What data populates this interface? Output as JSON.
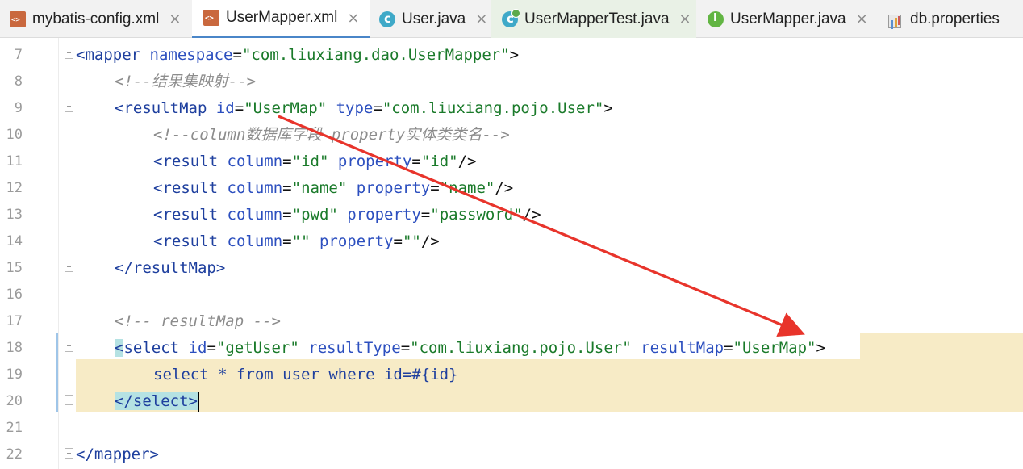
{
  "tabs": [
    {
      "label": "mybatis-config.xml",
      "icon": "xml-file-icon",
      "active": false
    },
    {
      "label": "UserMapper.xml",
      "icon": "xml-file-icon",
      "active": true
    },
    {
      "label": "User.java",
      "icon": "java-class-icon",
      "active": false
    },
    {
      "label": "UserMapperTest.java",
      "icon": "java-test-class-icon",
      "active": false
    },
    {
      "label": "UserMapper.java",
      "icon": "java-interface-icon",
      "active": false
    },
    {
      "label": "db.properties",
      "icon": "properties-file-icon",
      "active": false
    }
  ],
  "close_glyph": "×",
  "lines": [
    {
      "n": "7"
    },
    {
      "n": "8"
    },
    {
      "n": "9"
    },
    {
      "n": "10"
    },
    {
      "n": "11"
    },
    {
      "n": "12"
    },
    {
      "n": "13"
    },
    {
      "n": "14"
    },
    {
      "n": "15"
    },
    {
      "n": "16"
    },
    {
      "n": "17"
    },
    {
      "n": "18"
    },
    {
      "n": "19"
    },
    {
      "n": "20"
    },
    {
      "n": "21"
    },
    {
      "n": "22"
    }
  ],
  "code": {
    "l7": {
      "tag_open": "<mapper",
      "attr": "namespace",
      "eq": "=",
      "val": "\"com.liuxiang.dao.UserMapper\"",
      "close": ">"
    },
    "l8": {
      "comment": "<!--结果集映射-->"
    },
    "l9": {
      "tag_open": "<resultMap",
      "a1": "id",
      "v1": "\"UserMap\"",
      "a2": "type",
      "v2": "\"com.liuxiang.pojo.User\"",
      "close": ">"
    },
    "l10": {
      "comment": "<!--column数据库字段 property实体类类名-->"
    },
    "l11": {
      "tag": "<result",
      "a1": "column",
      "v1": "\"id\"",
      "a2": "property",
      "v2": "\"id\"",
      "end": "/>"
    },
    "l12": {
      "tag": "<result",
      "a1": "column",
      "v1": "\"name\"",
      "a2": "property",
      "v2": "\"name\"",
      "end": "/>"
    },
    "l13": {
      "tag": "<result",
      "a1": "column",
      "v1": "\"pwd\"",
      "a2": "property",
      "v2": "\"password\"",
      "end": "/>"
    },
    "l14": {
      "tag": "<result",
      "a1": "column",
      "v1": "\"\"",
      "a2": "property",
      "v2": "\"\"",
      "end": "/>"
    },
    "l15": {
      "tag_close": "</resultMap>"
    },
    "l17": {
      "comment": "<!-- resultMap -->"
    },
    "l18": {
      "lt": "<",
      "tag": "select",
      "a1": "id",
      "v1": "\"getUser\"",
      "a2": "resultType",
      "v2": "\"com.liuxiang.pojo.User\"",
      "a3": "resultMap",
      "v3": "\"UserMap\"",
      "close": ">"
    },
    "l19": {
      "sql": "select * from user where id=#{id}"
    },
    "l20": {
      "tag_close": "</select",
      "gt": ">"
    },
    "l22": {
      "tag_close": "</mapper>"
    }
  },
  "eq": "=",
  "colors": {
    "annotation_arrow": "#e8342b",
    "highlight": "#f7ebc6",
    "active_tab_underline": "#4a86c8"
  }
}
